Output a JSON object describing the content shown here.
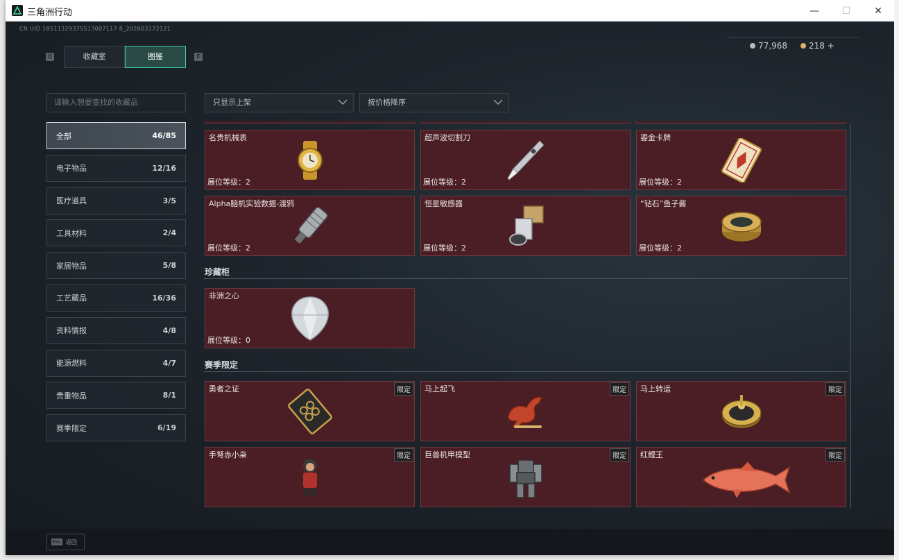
{
  "window": {
    "title": "三角洲行动",
    "minimize": "—",
    "maximize": "☐",
    "close": "✕"
  },
  "header": {
    "uid": "CN UID 18511329375513007117 8_202603172121",
    "key_left": "Q",
    "key_right": "E",
    "tabs": [
      {
        "label": "收藏室"
      },
      {
        "label": "图鉴",
        "active": true
      }
    ],
    "currency": [
      {
        "value": "77,968",
        "icon": "silver-coin-icon"
      },
      {
        "value": "218 +",
        "icon": "gold-coin-icon"
      }
    ]
  },
  "search": {
    "placeholder": "请输入想要查找的收藏品"
  },
  "filters": {
    "shelf": "只显示上架",
    "sort": "按价格降序"
  },
  "categories": [
    {
      "label": "全部",
      "count": "46/85",
      "active": true
    },
    {
      "label": "电子物品",
      "count": "12/16"
    },
    {
      "label": "医疗道具",
      "count": "3/5"
    },
    {
      "label": "工具材料",
      "count": "2/4"
    },
    {
      "label": "家居物品",
      "count": "5/8"
    },
    {
      "label": "工艺藏品",
      "count": "16/36"
    },
    {
      "label": "资料情报",
      "count": "4/8"
    },
    {
      "label": "能源燃料",
      "count": "4/7"
    },
    {
      "label": "贵重物品",
      "count": "8/1"
    },
    {
      "label": "赛季限定",
      "count": "6/19"
    }
  ],
  "items_top": [
    {
      "name": "名贵机械表",
      "level": "展位等级：2",
      "icon": "watch-icon"
    },
    {
      "name": "超声波切割刀",
      "level": "展位等级：2",
      "icon": "cutter-knife-icon"
    },
    {
      "name": "鎏金卡牌",
      "level": "展位等级：2",
      "icon": "gold-card-icon"
    },
    {
      "name": "Alpha脑机实验数据-渡鸦",
      "level": "展位等级：2",
      "icon": "data-drive-icon"
    },
    {
      "name": "恒星敏感器",
      "level": "展位等级：2",
      "icon": "star-sensor-icon"
    },
    {
      "name": "“钻石”鱼子酱",
      "level": "展位等级：2",
      "icon": "caviar-tin-icon"
    }
  ],
  "sections": {
    "cabinet": {
      "title": "珍藏柜",
      "items": [
        {
          "name": "非洲之心",
          "level": "展位等级：0",
          "icon": "diamond-icon"
        }
      ]
    },
    "season": {
      "title": "赛季限定",
      "badge": "限定",
      "items": [
        {
          "name": "勇者之证",
          "icon": "badge-card-icon"
        },
        {
          "name": "马上起飞",
          "icon": "horse-icon"
        },
        {
          "name": "马上转运",
          "icon": "gold-wheel-icon"
        },
        {
          "name": "手弩赤小枭",
          "icon": "figure-icon"
        },
        {
          "name": "巨兽机甲模型",
          "icon": "mech-icon"
        },
        {
          "name": "红鲤王",
          "icon": "koi-fish-icon"
        }
      ]
    }
  },
  "footer": {
    "esc_key": "Esc",
    "esc_label": "返回"
  }
}
